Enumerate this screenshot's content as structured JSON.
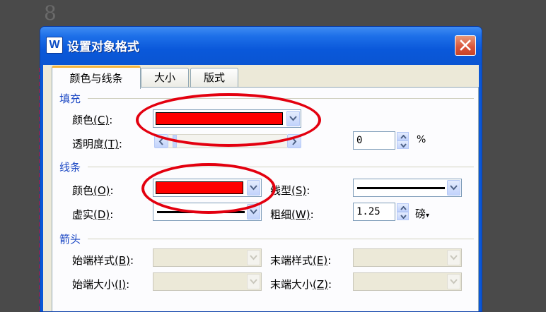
{
  "background": {
    "digit": "8"
  },
  "dialog": {
    "title": "设置对象格式",
    "app_icon": "W",
    "close_icon": "close-icon"
  },
  "tabs": [
    {
      "label": "颜色与线条",
      "active": true
    },
    {
      "label": "大小",
      "active": false
    },
    {
      "label": "版式",
      "active": false
    }
  ],
  "fill": {
    "section": "填充",
    "color_label": "颜色",
    "color_key": "(C)",
    "color_value": "#ff0000",
    "transparency_label": "透明度",
    "transparency_key": "(T)",
    "transparency_value": "0",
    "transparency_unit": "%",
    "transparency_level": 0
  },
  "line": {
    "section": "线条",
    "color_label": "颜色",
    "color_key": "(O)",
    "color_value": "#ff0000",
    "style_label": "线型",
    "style_key": "(S)",
    "dash_label": "虚实",
    "dash_key": "(D)",
    "weight_label": "粗细",
    "weight_key": "(W)",
    "weight_value": "1.25",
    "weight_unit": "磅"
  },
  "arrows": {
    "section": "箭头",
    "begin_style_label": "始端样式",
    "begin_style_key": "(B)",
    "end_style_label": "末端样式",
    "end_style_key": "(E)",
    "begin_size_label": "始端大小",
    "begin_size_key": "(I)",
    "end_size_label": "末端大小",
    "end_size_key": "(Z)"
  },
  "annotation_color": "#e3000f"
}
